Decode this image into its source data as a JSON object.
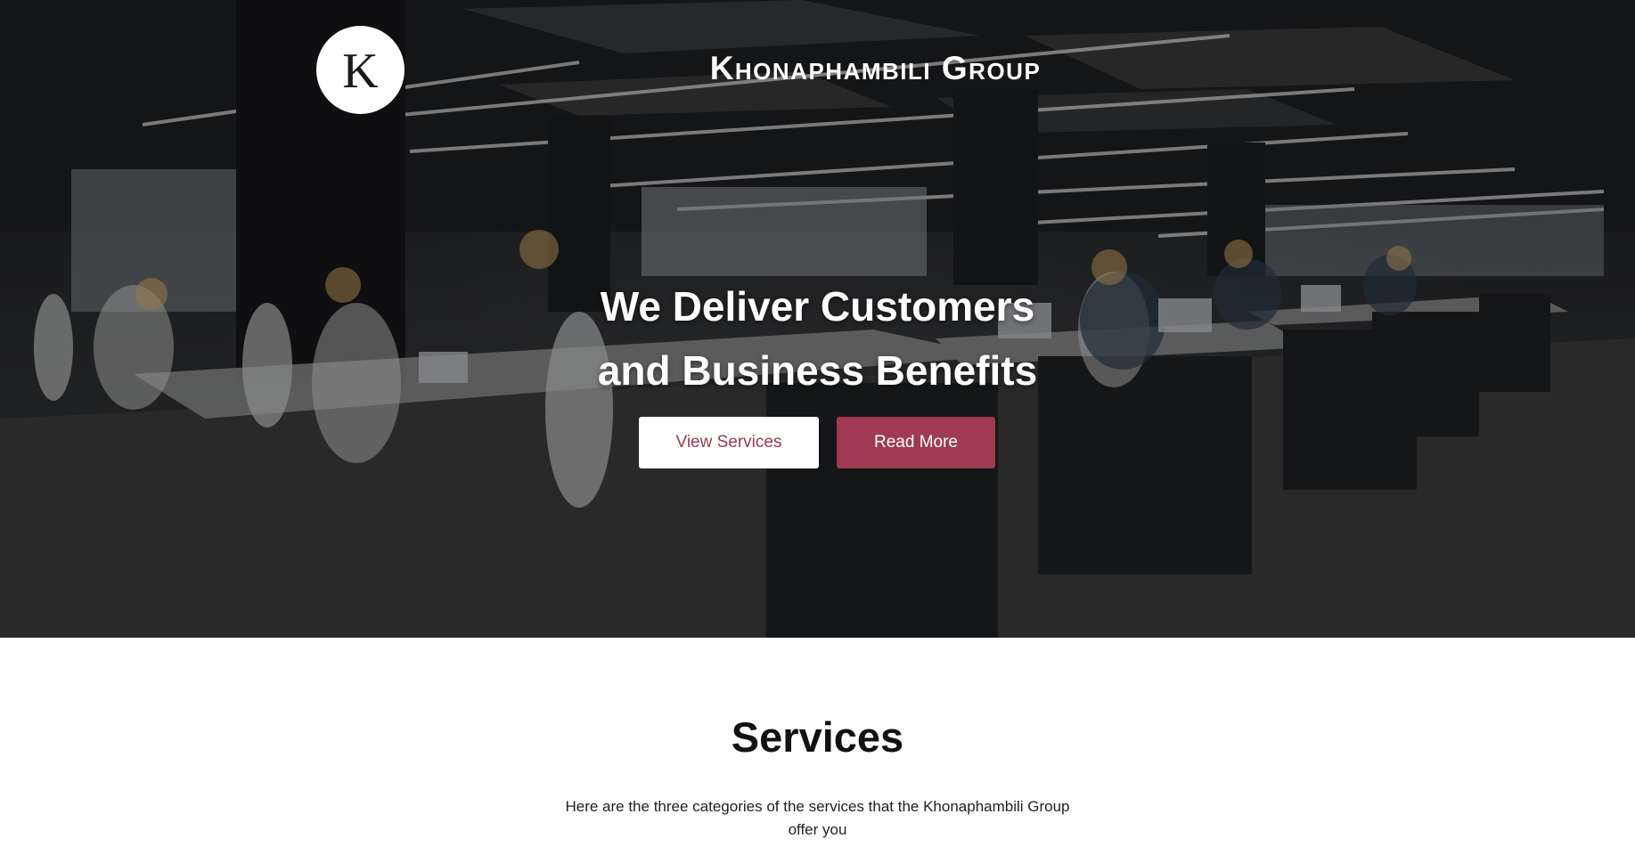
{
  "hero": {
    "logo_letter": "K",
    "brand": "Khonaphambili Group",
    "headline_line1": "We Deliver Customers",
    "headline_line2": "and Business Benefits",
    "buttons": {
      "view_services": "View Services",
      "read_more": "Read More"
    }
  },
  "services": {
    "title": "Services",
    "description": "Here are the three categories of the services that the Khonaphambili Group offer you"
  },
  "colors": {
    "accent": "#a03a51",
    "accent_text": "#9b3a4e",
    "hero_dark": "#232528",
    "white": "#ffffff"
  }
}
